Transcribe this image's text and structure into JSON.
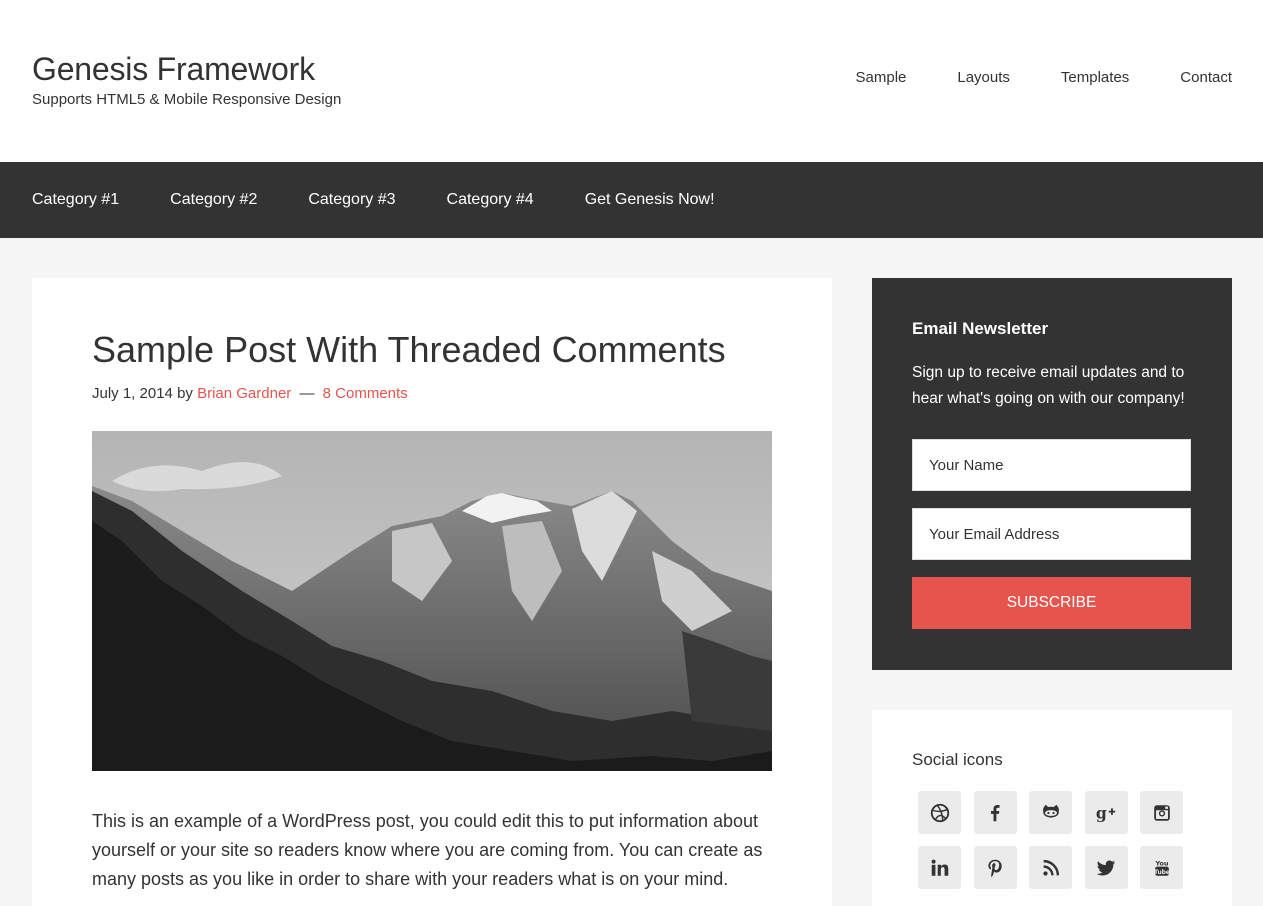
{
  "site": {
    "title": "Genesis Framework",
    "description": "Supports HTML5 & Mobile Responsive Design"
  },
  "header_nav": [
    "Sample",
    "Layouts",
    "Templates",
    "Contact"
  ],
  "primary_nav": [
    "Category #1",
    "Category #2",
    "Category #3",
    "Category #4",
    "Get Genesis Now!"
  ],
  "post": {
    "title": "Sample Post With Threaded Comments",
    "date": "July 1, 2014",
    "by": "by",
    "author": "Brian Gardner",
    "separator": "—",
    "comments": "8 Comments",
    "body": "This is an example of a WordPress post, you could edit this to put information about yourself or your site so readers know where you are coming from. You can create as many posts as you like in order to share with your readers what is on your mind."
  },
  "newsletter": {
    "title": "Email Newsletter",
    "text": "Sign up to receive email updates and to hear what's going on with our company!",
    "name_placeholder": "Your Name",
    "email_placeholder": "Your Email Address",
    "button": "Subscribe"
  },
  "social": {
    "title": "Social icons",
    "icons": [
      "dribbble-icon",
      "facebook-icon",
      "github-icon",
      "google-plus-icon",
      "instagram-icon",
      "linkedin-icon",
      "pinterest-icon",
      "rss-icon",
      "twitter-icon",
      "youtube-icon"
    ]
  },
  "colors": {
    "accent": "#e5554e",
    "dark": "#333333",
    "background": "#f5f5f5"
  }
}
